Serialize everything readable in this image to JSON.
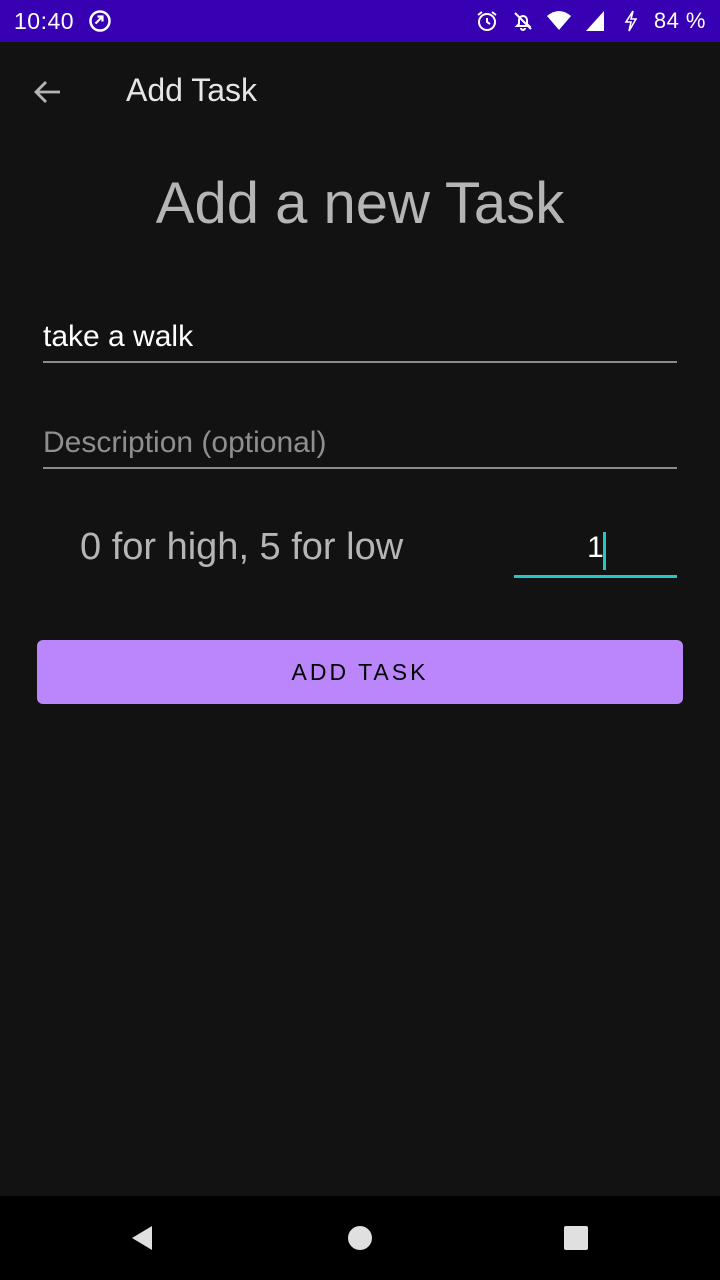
{
  "status_bar": {
    "time": "10:40",
    "battery": "84 %",
    "icons": [
      "sync-icon",
      "alarm-icon",
      "notifications-off-icon",
      "wifi-icon",
      "cell-signal-icon",
      "charging-icon"
    ]
  },
  "app_bar": {
    "title": "Add Task",
    "back_icon": "arrow-back-icon"
  },
  "form": {
    "heading": "Add a new Task",
    "title_value": "take a walk",
    "description_placeholder": "Description (optional)",
    "description_value": "",
    "priority_hint": "0 for high, 5 for low",
    "priority_value": "1"
  },
  "actions": {
    "add_task_label": "ADD TASK"
  },
  "nav_bar": {
    "icons": [
      "back-triangle-icon",
      "home-circle-icon",
      "recents-square-icon"
    ]
  },
  "colors": {
    "status_bar": "#3700b3",
    "background": "#121212",
    "accent": "#bb86fc",
    "focus_underline": "#26c6c6"
  }
}
